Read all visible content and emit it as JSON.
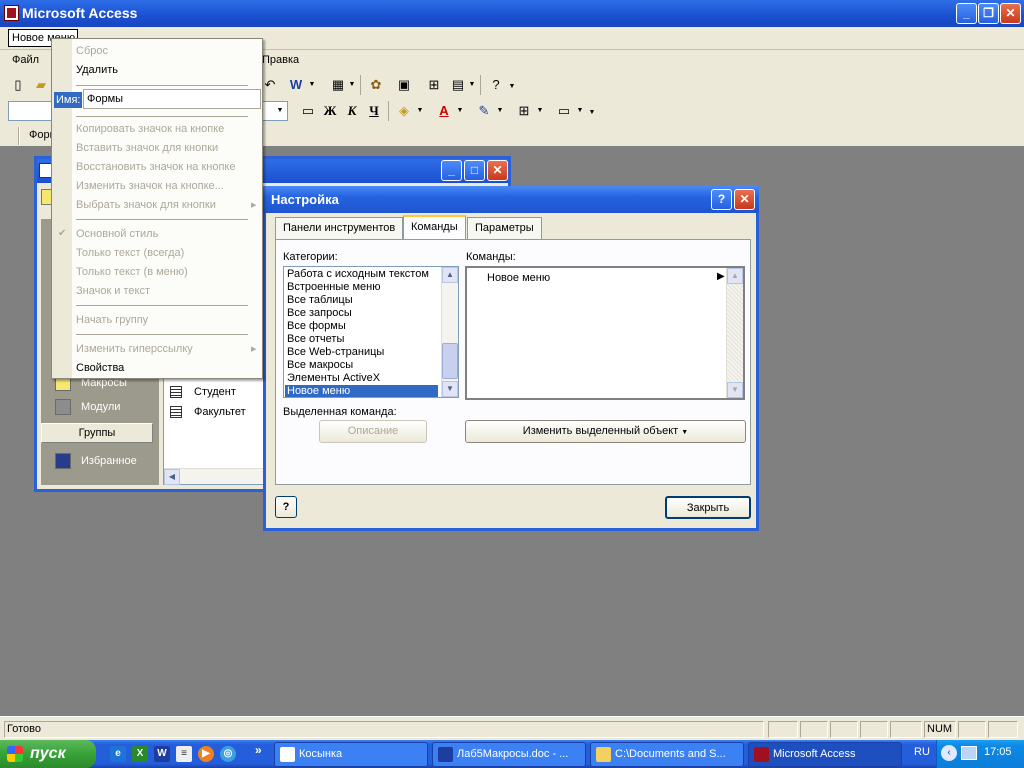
{
  "app": {
    "title": "Microsoft Access"
  },
  "menubar": {
    "new_menu": "Новое меню",
    "items": [
      "Файл",
      "Правка"
    ]
  },
  "toolbar": {
    "formula_fragment": "Форм"
  },
  "context_menu": {
    "reset": "Сброс",
    "delete": "Удалить",
    "name_label": "Имя:",
    "name_value": "Формы",
    "copy_icon": "Копировать значок на кнопке",
    "paste_icon": "Вставить значок для кнопки",
    "restore_icon": "Восстановить значок на кнопке",
    "edit_icon": "Изменить значок на кнопке...",
    "choose_icon": "Выбрать значок для кнопки",
    "default_style": "Основной стиль",
    "text_only_always": "Только текст (всегда)",
    "text_only_menu": "Только текст (в меню)",
    "icon_and_text": "Значок и текст",
    "begin_group": "Начать группу",
    "edit_hyperlink": "Изменить гиперссылку",
    "properties": "Свойства"
  },
  "db_window": {
    "nav": [
      "Макросы",
      "Модули"
    ],
    "groups_label": "Группы",
    "favorites": "Избранное",
    "rows": [
      "Студент",
      "Факультет"
    ]
  },
  "dialog": {
    "title": "Настройка",
    "tabs": [
      "Панели инструментов",
      "Команды",
      "Параметры"
    ],
    "categories_label": "Категории:",
    "commands_label": "Команды:",
    "categories": [
      "Работа с исходным текстом",
      "Встроенные меню",
      "Все таблицы",
      "Все запросы",
      "Все формы",
      "Все отчеты",
      "Все Web-страницы",
      "Все макросы",
      "Элементы ActiveX",
      "Новое меню"
    ],
    "command_item": "Новое меню",
    "selected_label": "Выделенная команда:",
    "description_button": "Описание",
    "modify_button": "Изменить выделенный объект",
    "close_button": "Закрыть"
  },
  "statusbar": {
    "text": "Готово",
    "num": "NUM"
  },
  "taskbar": {
    "start": "пуск",
    "tasks": [
      "Косынка",
      "Лаб5Макросы.doc - ...",
      "C:\\Documents and S...",
      "Microsoft Access"
    ],
    "lang": "RU",
    "clock": "17:05"
  }
}
